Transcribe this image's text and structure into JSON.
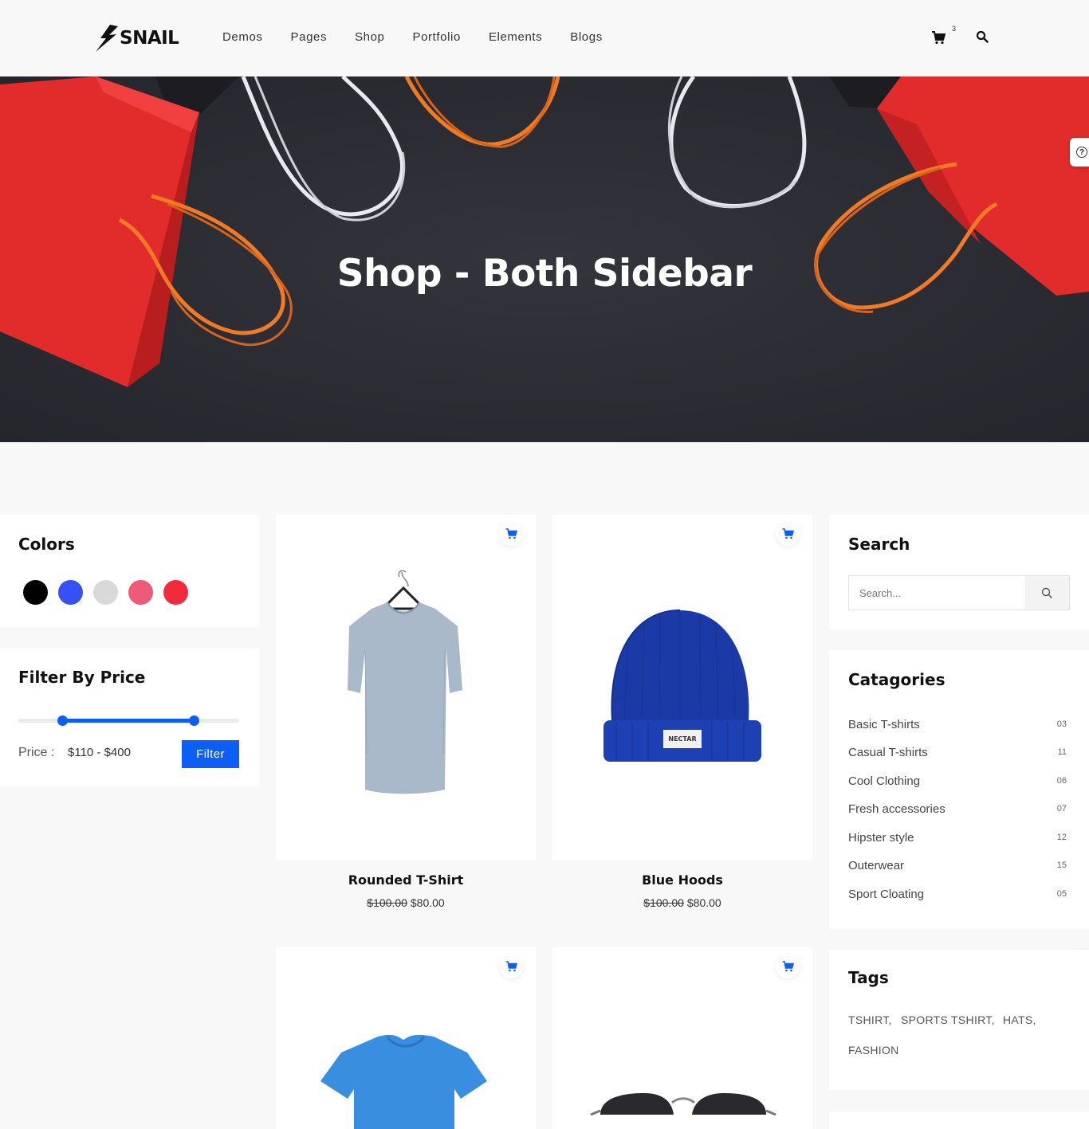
{
  "brand": {
    "name": "SNAIL"
  },
  "nav": [
    "Demos",
    "Pages",
    "Shop",
    "Portfolio",
    "Elements",
    "Blogs"
  ],
  "cart": {
    "count": "3"
  },
  "hero": {
    "title": "Shop - Both Sidebar"
  },
  "colors_widget": {
    "title": "Colors",
    "swatches": [
      "#000000",
      "#3550f5",
      "#d9d9d9",
      "#ef5a78",
      "#ef2b3c"
    ]
  },
  "price_widget": {
    "title": "Filter By Price",
    "label": "Price :",
    "range": "$110 - $400",
    "filter_label": "Filter",
    "slider": {
      "min_fraction": 0.2,
      "max_fraction": 0.795
    }
  },
  "products": [
    {
      "name": "Rounded T-Shirt",
      "old_price": "$100.00",
      "price": "$80.00"
    },
    {
      "name": "Blue Hoods",
      "old_price": "$100.00",
      "price": "$80.00"
    },
    {
      "name": "",
      "old_price": "",
      "price": ""
    },
    {
      "name": "",
      "old_price": "",
      "price": ""
    }
  ],
  "hat_label": "NECTAR",
  "search_widget": {
    "title": "Search",
    "placeholder": "Search..."
  },
  "categories_widget": {
    "title": "Catagories",
    "items": [
      {
        "label": "Basic T-shirts",
        "count": "03"
      },
      {
        "label": "Casual T-shirts",
        "count": "11"
      },
      {
        "label": "Cool Clothing",
        "count": "06"
      },
      {
        "label": "Fresh accessories",
        "count": "07"
      },
      {
        "label": "Hipster style",
        "count": "12"
      },
      {
        "label": "Outerwear",
        "count": "15"
      },
      {
        "label": "Sport Cloating",
        "count": "05"
      }
    ]
  },
  "tags_widget": {
    "title": "Tags",
    "tags": [
      "TSHIRT,",
      "SPORTS TSHIRT,",
      "HATS,",
      "FASHION"
    ]
  },
  "help_icon": "?"
}
